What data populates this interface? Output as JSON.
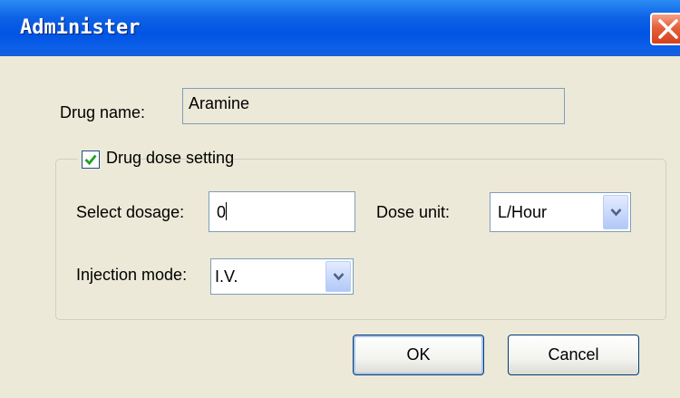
{
  "window": {
    "title": "Administer"
  },
  "drug_name": {
    "label": "Drug name:",
    "value": "Aramine"
  },
  "dose_group": {
    "label": "Drug dose setting",
    "checked": true
  },
  "dosage": {
    "label": "Select dosage:",
    "value": "0"
  },
  "dose_unit": {
    "label": "Dose unit:",
    "selected": "L/Hour"
  },
  "injection_mode": {
    "label": "Injection mode:",
    "selected": "I.V."
  },
  "buttons": {
    "ok": "OK",
    "cancel": "Cancel"
  },
  "icons": {
    "close": "close-icon",
    "check": "checkmark-icon",
    "dropdown": "chevron-down-icon"
  }
}
